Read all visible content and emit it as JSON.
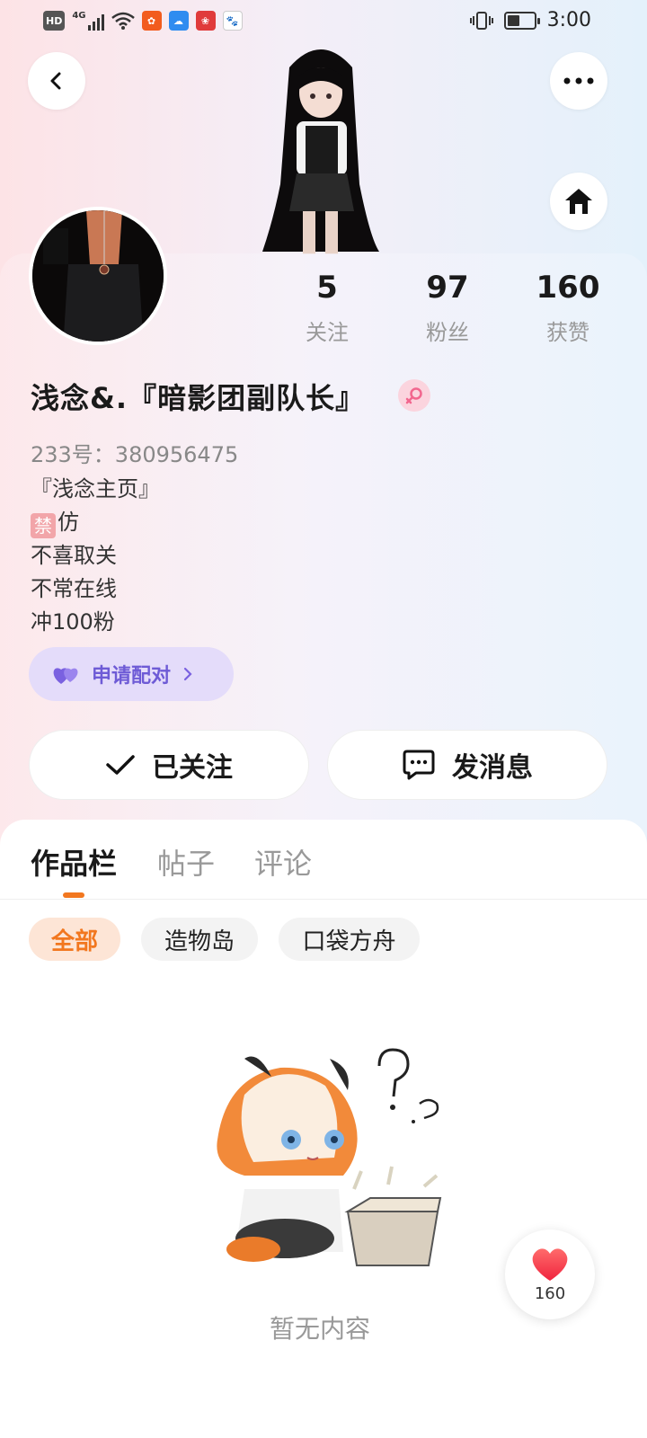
{
  "status_bar": {
    "time": "3:00",
    "network_label": "HD",
    "signal_label": "4G",
    "battery_level": 0.45,
    "icons": [
      "hd-icon",
      "signal-icon",
      "wifi-icon",
      "app-icon-1",
      "cloud-icon",
      "app-icon-2",
      "baidu-icon",
      "vibrate-icon",
      "battery-icon"
    ]
  },
  "header": {
    "back_icon": "chevron-left-icon",
    "more_icon": "more-dots-icon",
    "home_icon": "home-icon"
  },
  "profile": {
    "username": "浅念&.『暗影团副队长』",
    "gender": "female",
    "uid": "233号：380956475",
    "bio": {
      "line1": "『浅念主页』",
      "ban_mark": "禁",
      "line2_rest": "仿",
      "line3": "不喜取关",
      "line4": "不常在线",
      "line5": "冲100粉"
    },
    "stats": {
      "following": {
        "value": "5",
        "label": "关注"
      },
      "followers": {
        "value": "97",
        "label": "粉丝"
      },
      "likes": {
        "value": "160",
        "label": "获赞"
      }
    }
  },
  "pair_button": {
    "label": "申请配对"
  },
  "actions": {
    "follow_label": "已关注",
    "message_label": "发消息"
  },
  "tabs": [
    {
      "label": "作品栏",
      "active": true
    },
    {
      "label": "帖子",
      "active": false
    },
    {
      "label": "评论",
      "active": false
    }
  ],
  "filters": [
    {
      "label": "全部",
      "active": true
    },
    {
      "label": "造物岛",
      "active": false
    },
    {
      "label": "口袋方舟",
      "active": false
    }
  ],
  "empty_state": {
    "text": "暂无内容"
  },
  "like_fab": {
    "count": "160"
  },
  "colors": {
    "accent": "#f2771f",
    "pair_text": "#6e5bd6",
    "pair_bg": "#e4dcfa",
    "heart": "#f53b4e"
  }
}
